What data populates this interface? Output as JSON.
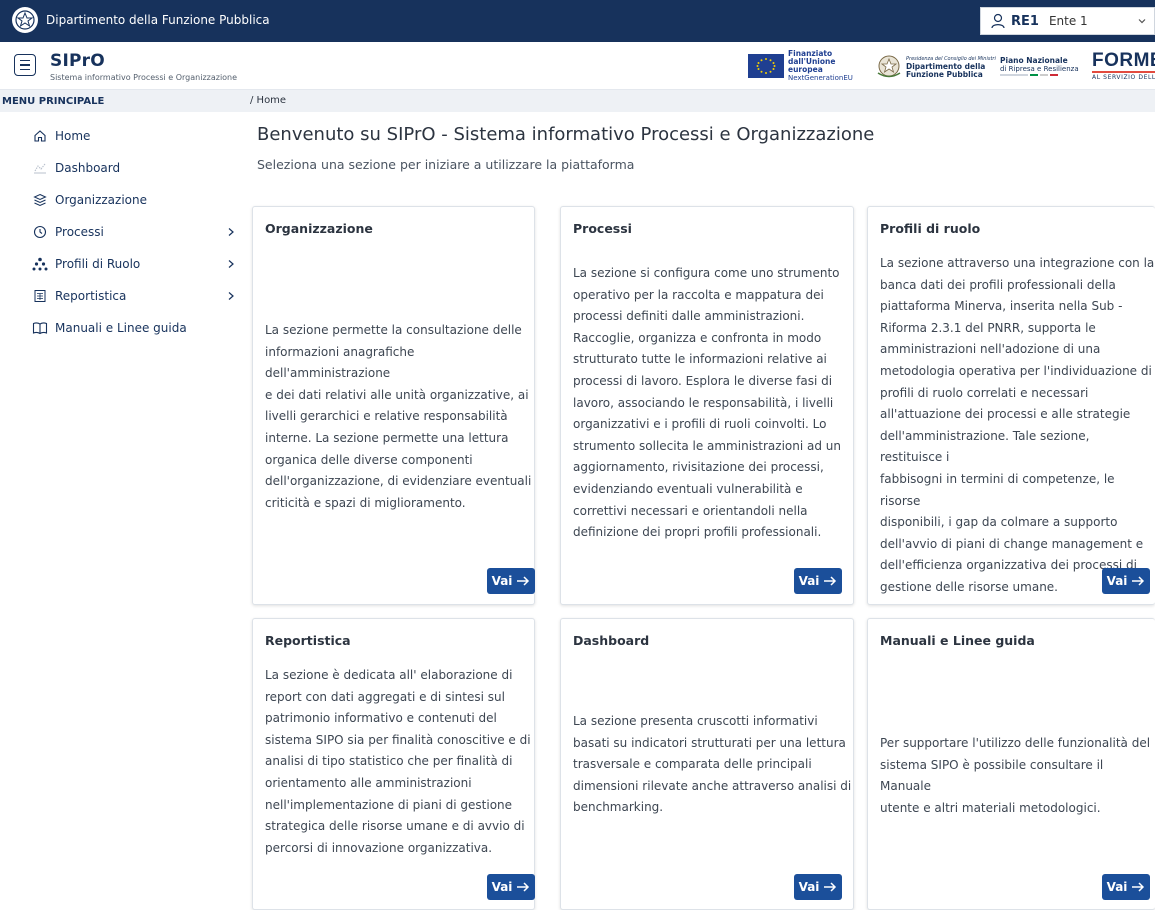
{
  "topbar": {
    "department": "Dipartimento della Funzione Pubblica",
    "user_code": "RE1",
    "ente": "Ente 1"
  },
  "header": {
    "app_name": "SIPrO",
    "app_subtitle": "Sistema informativo Processi e Organizzazione",
    "logos": {
      "eu_line1": "Finanziato",
      "eu_line2": "dall'Unione europea",
      "eu_line3": "NextGenerationEU",
      "dfp_small": "Presidenza del Consiglio dei Ministri",
      "dfp_line1": "Dipartimento della",
      "dfp_line2": "Funzione Pubblica",
      "pnrr_line1": "Piano Nazionale",
      "pnrr_line2": "di Ripresa e Resilienza",
      "formez_big": "FORMEZ",
      "formez_small": "AL SERVIZIO DELLA PA"
    }
  },
  "sidebar": {
    "heading": "MENU PRINCIPALE",
    "items": [
      {
        "label": "Home",
        "icon": "home-icon"
      },
      {
        "label": "Dashboard",
        "icon": "chart-icon"
      },
      {
        "label": "Organizzazione",
        "icon": "stack-icon"
      },
      {
        "label": "Processi",
        "icon": "process-icon",
        "has_children": true
      },
      {
        "label": "Profili di Ruolo",
        "icon": "hierarchy-icon",
        "has_children": true
      },
      {
        "label": "Reportistica",
        "icon": "report-icon",
        "has_children": true
      },
      {
        "label": "Manuali e Linee guida",
        "icon": "book-icon"
      }
    ]
  },
  "breadcrumb": "/ Home",
  "main": {
    "title": "Benvenuto su SIPrO - Sistema informativo Processi e Organizzazione",
    "subtitle": "Seleziona una sezione per iniziare a utilizzare la piattaforma"
  },
  "cards": [
    {
      "title": "Organizzazione",
      "lines": [
        "La sezione permette la consultazione delle",
        "informazioni anagrafiche dell'amministrazione",
        "e dei dati relativi alle unità organizzative, ai",
        "livelli gerarchici e relative responsabilità",
        "interne. La sezione permette una lettura",
        "organica delle diverse componenti",
        "dell'organizzazione, di evidenziare eventuali",
        "criticità e spazi di miglioramento."
      ],
      "button": "Vai"
    },
    {
      "title": "Processi",
      "lines": [
        "La sezione si configura come uno strumento",
        "operativo per la raccolta e mappatura dei",
        "processi definiti dalle amministrazioni.",
        "Raccoglie, organizza e confronta in modo",
        "strutturato tutte le informazioni relative ai",
        "processi di lavoro. Esplora le diverse fasi di",
        "lavoro, associando le responsabilità, i livelli",
        "organizzativi e i profili di ruoli coinvolti. Lo",
        "strumento sollecita le amministrazioni ad un",
        "aggiornamento, rivisitazione dei processi,",
        "evidenziando eventuali vulnerabilità e",
        "correttivi necessari e orientandoli nella",
        "definizione dei propri profili professionali."
      ],
      "button": "Vai"
    },
    {
      "title": "Profili di ruolo",
      "lines": [
        "La sezione attraverso una integrazione con la",
        "banca dati dei profili professionali della",
        "piattaforma Minerva, inserita nella Sub -",
        "Riforma 2.3.1 del PNRR, supporta le",
        "amministrazioni nell'adozione di una",
        "metodologia operativa per l'individuazione di",
        "profili di ruolo correlati e necessari",
        "all'attuazione dei processi e alle strategie",
        "dell'amministrazione. Tale sezione, restituisce i",
        "fabbisogni in termini di competenze, le risorse",
        "disponibili, i gap da colmare a supporto",
        "dell'avvio di piani di change management e",
        "dell'efficienza organizzativa dei processi di",
        "gestione delle risorse umane."
      ],
      "button": "Vai"
    },
    {
      "title": "Reportistica",
      "lines": [
        "La sezione è dedicata all' elaborazione di",
        "report con dati aggregati e di sintesi sul",
        "patrimonio informativo e contenuti del",
        "sistema SIPO sia per finalità conoscitive e di",
        "analisi di tipo statistico che per finalità di",
        "orientamento alle amministrazioni",
        "nell'implementazione di piani di gestione",
        "strategica delle risorse umane e di avvio di",
        "percorsi di innovazione organizzativa."
      ],
      "button": "Vai"
    },
    {
      "title": "Dashboard",
      "lines": [
        "La sezione presenta cruscotti informativi",
        "basati su indicatori strutturati per una lettura",
        "trasversale e comparata delle principali",
        "dimensioni rilevate anche attraverso analisi di",
        "benchmarking."
      ],
      "button": "Vai"
    },
    {
      "title": "Manuali e Linee guida",
      "lines": [
        "Per supportare l'utilizzo delle funzionalità del",
        "sistema SIPO è possibile consultare il Manuale",
        "utente e altri materiali metodologici."
      ],
      "button": "Vai"
    }
  ],
  "colors": {
    "topbar": "#17325c",
    "primary_button": "#1b4f9a",
    "sidebar_text": "#17325c"
  }
}
